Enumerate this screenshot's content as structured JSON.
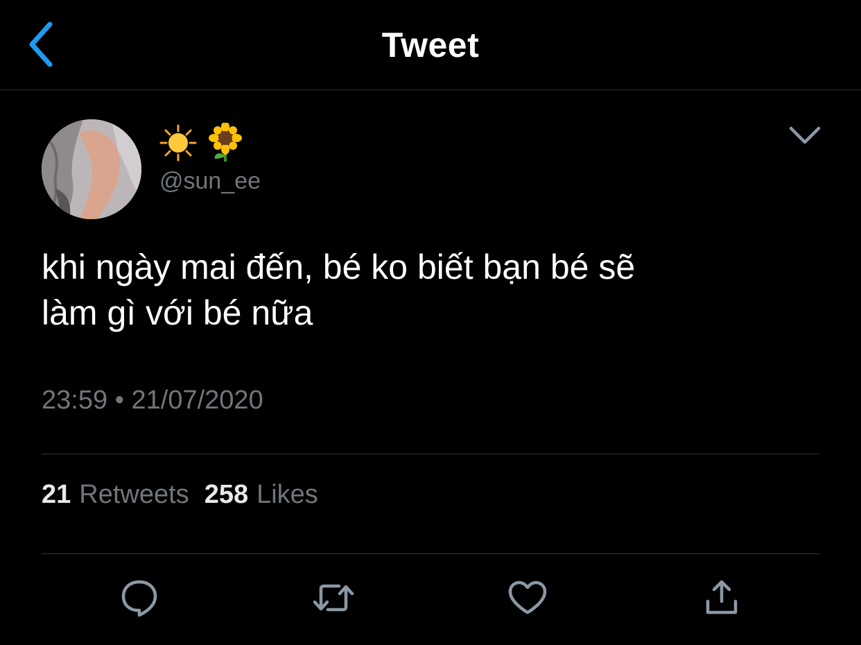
{
  "header": {
    "title": "Tweet",
    "back_icon": "chevron-left-icon"
  },
  "author": {
    "display_name_icons": [
      "sun-emoji",
      "sunflower-emoji"
    ],
    "handle": "@sun_ee"
  },
  "tweet": {
    "text": "khi ngày mai đến, bé ko biết bạn bé sẽ\nlàm gì với bé nữa",
    "timestamp": "23:59 • 21/07/2020"
  },
  "stats": {
    "retweets_count": "21",
    "retweets_label": "Retweets",
    "likes_count": "258",
    "likes_label": "Likes"
  },
  "actions": [
    "reply-icon",
    "retweet-icon",
    "like-icon",
    "share-icon"
  ],
  "colors": {
    "background": "#000000",
    "accent": "#1d9bf0",
    "secondary_text": "#71767b",
    "divider": "#2f3336",
    "icon": "#8b98a5"
  }
}
